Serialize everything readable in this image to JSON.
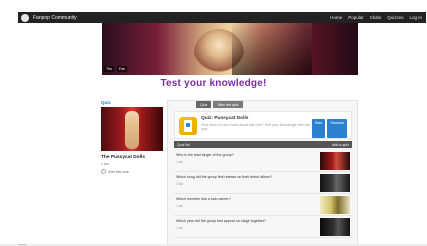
{
  "app": {
    "brand": "Fanpop Community"
  },
  "topnav": {
    "items": [
      "Home",
      "Popular",
      "Clubs",
      "Quizzes",
      "Log In"
    ]
  },
  "banner": {
    "tags": [
      "The",
      "Fan"
    ]
  },
  "headline": "Test your knowledge!",
  "sidebar": {
    "title": "Quiz",
    "club_name": "The Pussycat Dolls",
    "sub": "1 fan",
    "join": "Join this club"
  },
  "tabs": [
    "Quiz",
    "Take the quiz"
  ],
  "card": {
    "title": "Quiz: Pussycat Dolls",
    "text": "How much do you know about this club? Test your knowledge with this quiz.",
    "buttons": [
      "Start",
      "Random"
    ]
  },
  "list_header": {
    "left": "Quiz list",
    "right": "Add a quiz"
  },
  "quiz_items": [
    {
      "title": "Who is the lead singer of the group?",
      "meta": "1 fan",
      "thumb": "r"
    },
    {
      "title": "Which song did the group first release on their debut album?",
      "meta": "1 fan",
      "thumb": "d"
    },
    {
      "title": "Which member has a solo career?",
      "meta": "1 fan",
      "thumb": "y"
    },
    {
      "title": "Which year did the group first appear on stage together?",
      "meta": "1 fan",
      "thumb": "b"
    }
  ]
}
